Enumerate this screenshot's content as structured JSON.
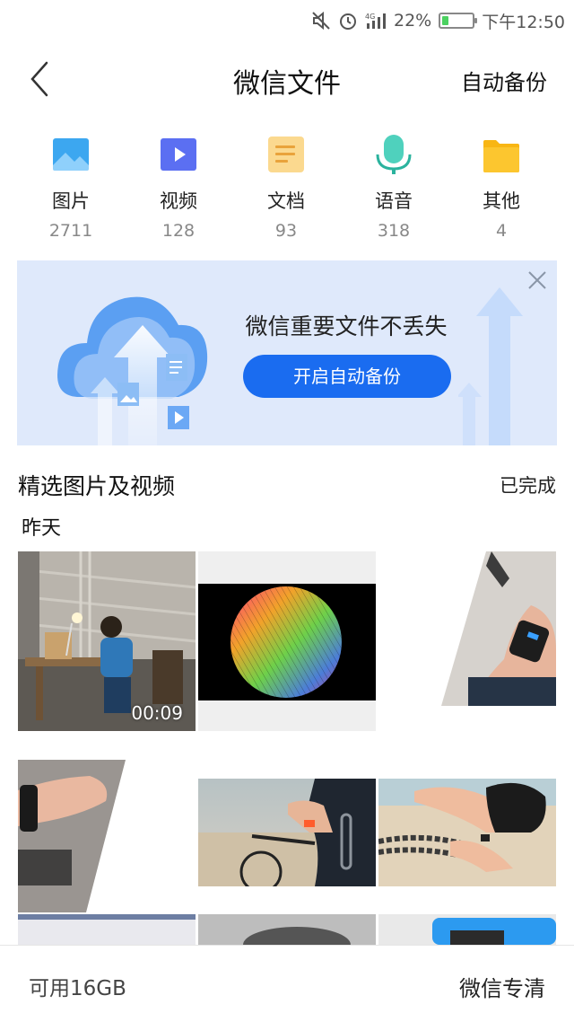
{
  "status_bar": {
    "network": "4G",
    "battery_percent": "22%",
    "battery_level": 0.22,
    "time": "下午12:50",
    "icons": [
      "mute-icon",
      "alarm-icon",
      "signal-icon",
      "battery-icon"
    ]
  },
  "header": {
    "title": "微信文件",
    "right_action": "自动备份",
    "back_icon": "chevron-left-icon"
  },
  "categories": [
    {
      "label": "图片",
      "count": "2711",
      "icon": "image-icon",
      "color": "#3ca7f0"
    },
    {
      "label": "视频",
      "count": "128",
      "icon": "video-icon",
      "color": "#5b6ff2"
    },
    {
      "label": "文档",
      "count": "93",
      "icon": "document-icon",
      "color": "#f5c16c"
    },
    {
      "label": "语音",
      "count": "318",
      "icon": "microphone-icon",
      "color": "#4fd1bd"
    },
    {
      "label": "其他",
      "count": "4",
      "icon": "folder-icon",
      "color": "#f8b614"
    }
  ],
  "banner": {
    "text": "微信重要文件不丢失",
    "button_label": "开启自动备份",
    "background": "#dfe9fb",
    "button_color": "#1a6cf0"
  },
  "section": {
    "title": "精选图片及视频",
    "action": "已完成",
    "date_group": "昨天"
  },
  "media": [
    {
      "kind": "video",
      "duration": "00:09",
      "subject": "boy at desk"
    },
    {
      "kind": "image",
      "subject": "colorful silicon wafer"
    },
    {
      "kind": "image",
      "subject": "wrist band on arm"
    },
    {
      "kind": "image",
      "subject": "wrist band hand"
    },
    {
      "kind": "image",
      "subject": "cyclist with band"
    },
    {
      "kind": "image",
      "subject": "woman on beach with band"
    },
    {
      "kind": "image",
      "subject": "partial"
    },
    {
      "kind": "image",
      "subject": "partial"
    },
    {
      "kind": "image",
      "subject": "partial"
    }
  ],
  "bottom_bar": {
    "storage": "可用16GB",
    "clean": "微信专清"
  }
}
